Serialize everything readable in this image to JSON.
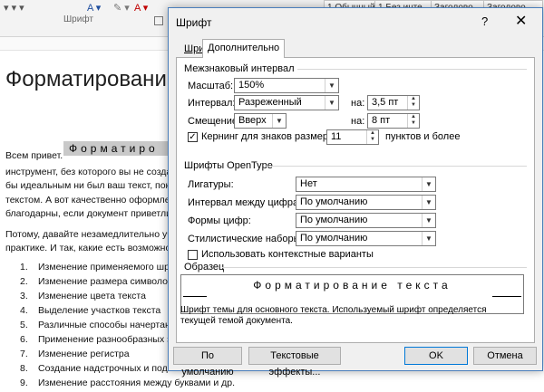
{
  "word": {
    "ribbon_group": "Шрифт",
    "ribbon_styles": [
      "1 Обычный",
      "1 Без инте...",
      "Заголово...",
      "Заголово..."
    ],
    "heading": "Форматировани",
    "selected_text": "Форматиро",
    "lines": [
      "Всем привет.",
      "инструмент, без которого вы не созда",
      "бы идеальным ни был ваш текст, пок",
      "текстом. А вот качественно оформлен",
      "благодарны, если документ приветли",
      "Потому, давайте незамедлительно уч",
      "практике. И так, какие есть возможно"
    ],
    "list": [
      {
        "num": "1.",
        "text": "Изменение применяемого шр"
      },
      {
        "num": "2.",
        "text": "Изменение размера символо"
      },
      {
        "num": "3.",
        "text": "Изменение цвета текста"
      },
      {
        "num": "4.",
        "text": "Выделение участков текста"
      },
      {
        "num": "5.",
        "text": "Различные способы начертан"
      },
      {
        "num": "6.",
        "text": "Применение разнообразных з"
      },
      {
        "num": "7.",
        "text": "Изменение регистра"
      },
      {
        "num": "8.",
        "text": "Создание надстрочных и подс"
      },
      {
        "num": "9.",
        "text": "Изменение расстояния между буквами и др."
      }
    ]
  },
  "dialog": {
    "title": "Шрифт",
    "help": "?",
    "close": "✕",
    "tabs": {
      "font": "Шрифт",
      "advanced": "Дополнительно"
    },
    "spacing_section": "Межзнаковый интервал",
    "scale": {
      "label": "Масштаб:",
      "value": "150%"
    },
    "spacing": {
      "label": "Интервал:",
      "value": "Разреженный",
      "by_label": "на:",
      "by_value": "3,5 пт"
    },
    "position": {
      "label": "Смещение:",
      "value": "Вверх",
      "by_label": "на:",
      "by_value": "8 пт"
    },
    "kerning": {
      "label": "Кернинг для знаков размером:",
      "value": "11",
      "suffix": "пунктов и более",
      "checked": true
    },
    "opentype_section": "Шрифты OpenType",
    "ligatures": {
      "label": "Лигатуры:",
      "value": "Нет"
    },
    "num_spacing": {
      "label": "Интервал между цифрами:",
      "value": "По умолчанию"
    },
    "num_forms": {
      "label": "Формы цифр:",
      "value": "По умолчанию"
    },
    "stylistic_sets": {
      "label": "Стилистические наборы:",
      "value": "По умолчанию"
    },
    "contextual": {
      "label": "Использовать контекстные варианты",
      "checked": false
    },
    "preview_section": "Образец",
    "preview_text": "Форматирование текста",
    "note": "Шрифт темы для основного текста. Используемый шрифт определяется текущей темой документа.",
    "buttons": {
      "default": "По умолчанию",
      "effects": "Текстовые эффекты...",
      "ok": "OK",
      "cancel": "Отмена"
    }
  }
}
